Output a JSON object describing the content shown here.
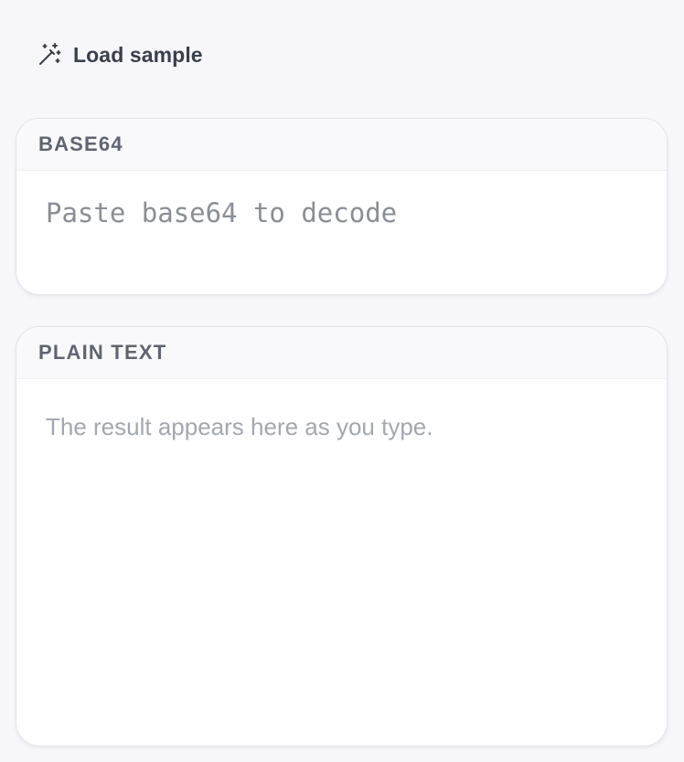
{
  "toolbar": {
    "load_sample_label": "Load sample",
    "load_sample_icon": "magic-wand-icon"
  },
  "base64_panel": {
    "title": "BASE64",
    "input_value": "",
    "input_placeholder": "Paste base64 to decode"
  },
  "plain_panel": {
    "title": "PLAIN TEXT",
    "placeholder": "The result appears here as you type."
  },
  "colors": {
    "background": "#f7f7fb",
    "card": "#ffffff",
    "title_text": "#5f6470",
    "placeholder_text": "#a3a7af"
  }
}
